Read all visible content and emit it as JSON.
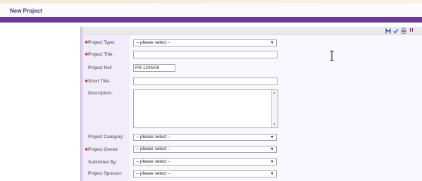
{
  "header": {
    "title": "New Project"
  },
  "toolbar": {
    "icons": [
      "save-icon",
      "check-icon",
      "print-icon",
      "help-icon"
    ],
    "help_glyph": "H"
  },
  "form": {
    "project_type": {
      "label": "Project Type:",
      "value": "-- please select --",
      "required": true
    },
    "project_title": {
      "label": "Project Title:",
      "value": "",
      "required": true
    },
    "project_ref": {
      "label": "Project Ref:",
      "value": "PR-1295/08",
      "required": false
    },
    "short_title": {
      "label": "Short Title:",
      "value": "",
      "required": true
    },
    "description": {
      "label": "Description:",
      "value": "",
      "required": false
    },
    "project_category": {
      "label": "Project Category:",
      "value": "-- please select --",
      "required": false
    },
    "project_owner": {
      "label": "Project Owner:",
      "value": "-- please select --",
      "required": true
    },
    "submitted_by": {
      "label": "Submitted By:",
      "value": "-- please select --",
      "required": false
    },
    "project_sponsor": {
      "label": "Project Sponsor:",
      "value": "-- please select --",
      "required": false
    }
  },
  "colors": {
    "accent": "#6b3a95",
    "title": "#4b2f7f",
    "required_marker": "#d02020",
    "label_bg": "#f1ecfa"
  }
}
